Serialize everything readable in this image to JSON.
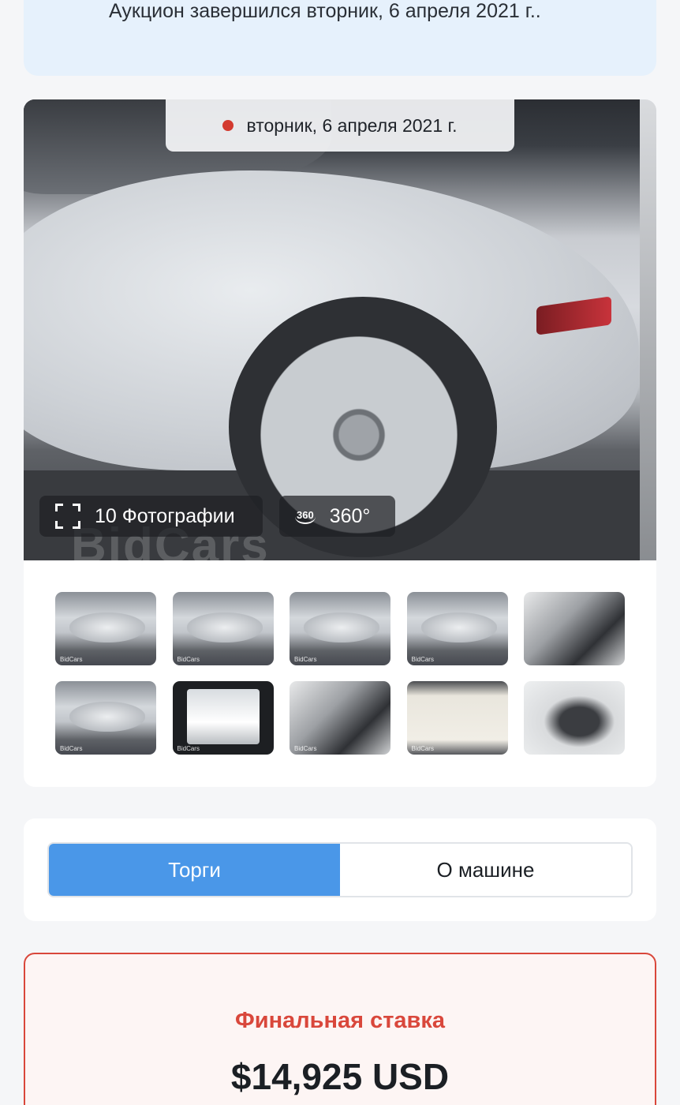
{
  "status": {
    "text": "Аукцион завершился вторник, 6 апреля 2021 г..",
    "icon": "refresh-icon"
  },
  "gallery": {
    "auction_date": "вторник, 6 апреля 2021 г.",
    "photos_button_label": "10 Фотографии",
    "view_360_label": "360°",
    "view_360_icon_text": "360",
    "watermark": "BidCars",
    "thumbnail_labels": [
      "BidCars",
      "BidCars",
      "BidCars",
      "BidCars",
      "",
      "BidCars",
      "BidCars",
      "BidCars",
      "BidCars",
      ""
    ]
  },
  "tabs": {
    "bidding_label": "Торги",
    "about_label": "О машине"
  },
  "final_bid": {
    "label": "Финальная ставка",
    "value": "$14,925 USD"
  },
  "colors": {
    "accent": "#4a97e8",
    "alert": "#d9473b",
    "status_bg": "#e6f1fc"
  }
}
